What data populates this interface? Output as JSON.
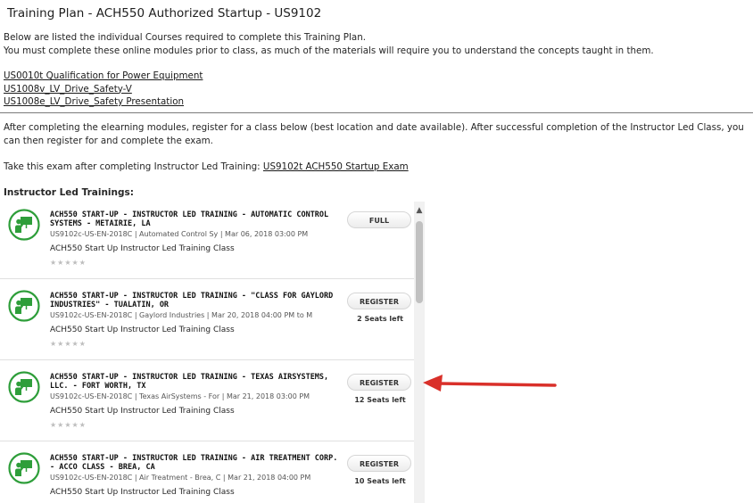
{
  "page": {
    "title": "Training Plan - ACH550 Authorized Startup - US9102",
    "intro_line1": "Below are listed the individual Courses required to complete this Training Plan.",
    "intro_line2": "You must complete these online modules prior to class, as much of the materials will require you to understand the concepts taught in them.",
    "module_links": [
      "US0010t Qualification for Power Equipment",
      "US1008v_LV_Drive_Safety-V",
      "US1008e_LV_Drive_Safety Presentation"
    ],
    "after_text": "After completing the elearning modules, register for a class below (best location and date available). After successful completion of the Instructor Led Class, you can then register for and complete the exam.",
    "exam_prefix": "Take this exam after completing Instructor Led Training: ",
    "exam_link": "US9102t ACH550 Startup Exam",
    "ilt_heading": "Instructor Led Trainings:"
  },
  "courses": [
    {
      "title": "ACH550 START-UP - INSTRUCTOR LED TRAINING - AUTOMATIC CONTROL SYSTEMS - METAIRIE, LA",
      "meta": "US9102c-US-EN-2018C | Automated Control Sy | Mar 06, 2018 03:00 PM",
      "description": "ACH550 Start Up Instructor Led Training Class",
      "rating": "★★★★★",
      "button": "FULL",
      "seats": ""
    },
    {
      "title": "ACH550 START-UP - INSTRUCTOR LED TRAINING - \"CLASS FOR GAYLORD INDUSTRIES\" - TUALATIN, OR",
      "meta": "US9102c-US-EN-2018C | Gaylord Industries | Mar 20, 2018 04:00 PM to M",
      "description": "ACH550 Start Up Instructor Led Training Class",
      "rating": "★★★★★",
      "button": "REGISTER",
      "seats": "2 Seats left"
    },
    {
      "title": "ACH550 START-UP - INSTRUCTOR LED TRAINING - TEXAS AIRSYSTEMS, LLC. - FORT WORTH, TX",
      "meta": "US9102c-US-EN-2018C | Texas AirSystems - For | Mar 21, 2018 03:00 PM",
      "description": "ACH550 Start Up Instructor Led Training Class",
      "rating": "★★★★★",
      "button": "REGISTER",
      "seats": "12 Seats left"
    },
    {
      "title": "ACH550 START-UP - INSTRUCTOR LED TRAINING - AIR TREATMENT CORP. - ACCO CLASS - BREA, CA",
      "meta": "US9102c-US-EN-2018C | Air Treatment - Brea, C | Mar 21, 2018 04:00 PM",
      "description": "ACH550 Start Up Instructor Led Training Class",
      "rating": "",
      "button": "REGISTER",
      "seats": "10 Seats left"
    }
  ],
  "icons": {
    "course": "instructor-presentation-icon",
    "scroll_up": "chevron-up-icon",
    "annotation": "red-arrow-icon"
  },
  "colors": {
    "icon_green": "#2e9e3a",
    "arrow_red": "#d9302a",
    "link": "#1a1a1a"
  }
}
